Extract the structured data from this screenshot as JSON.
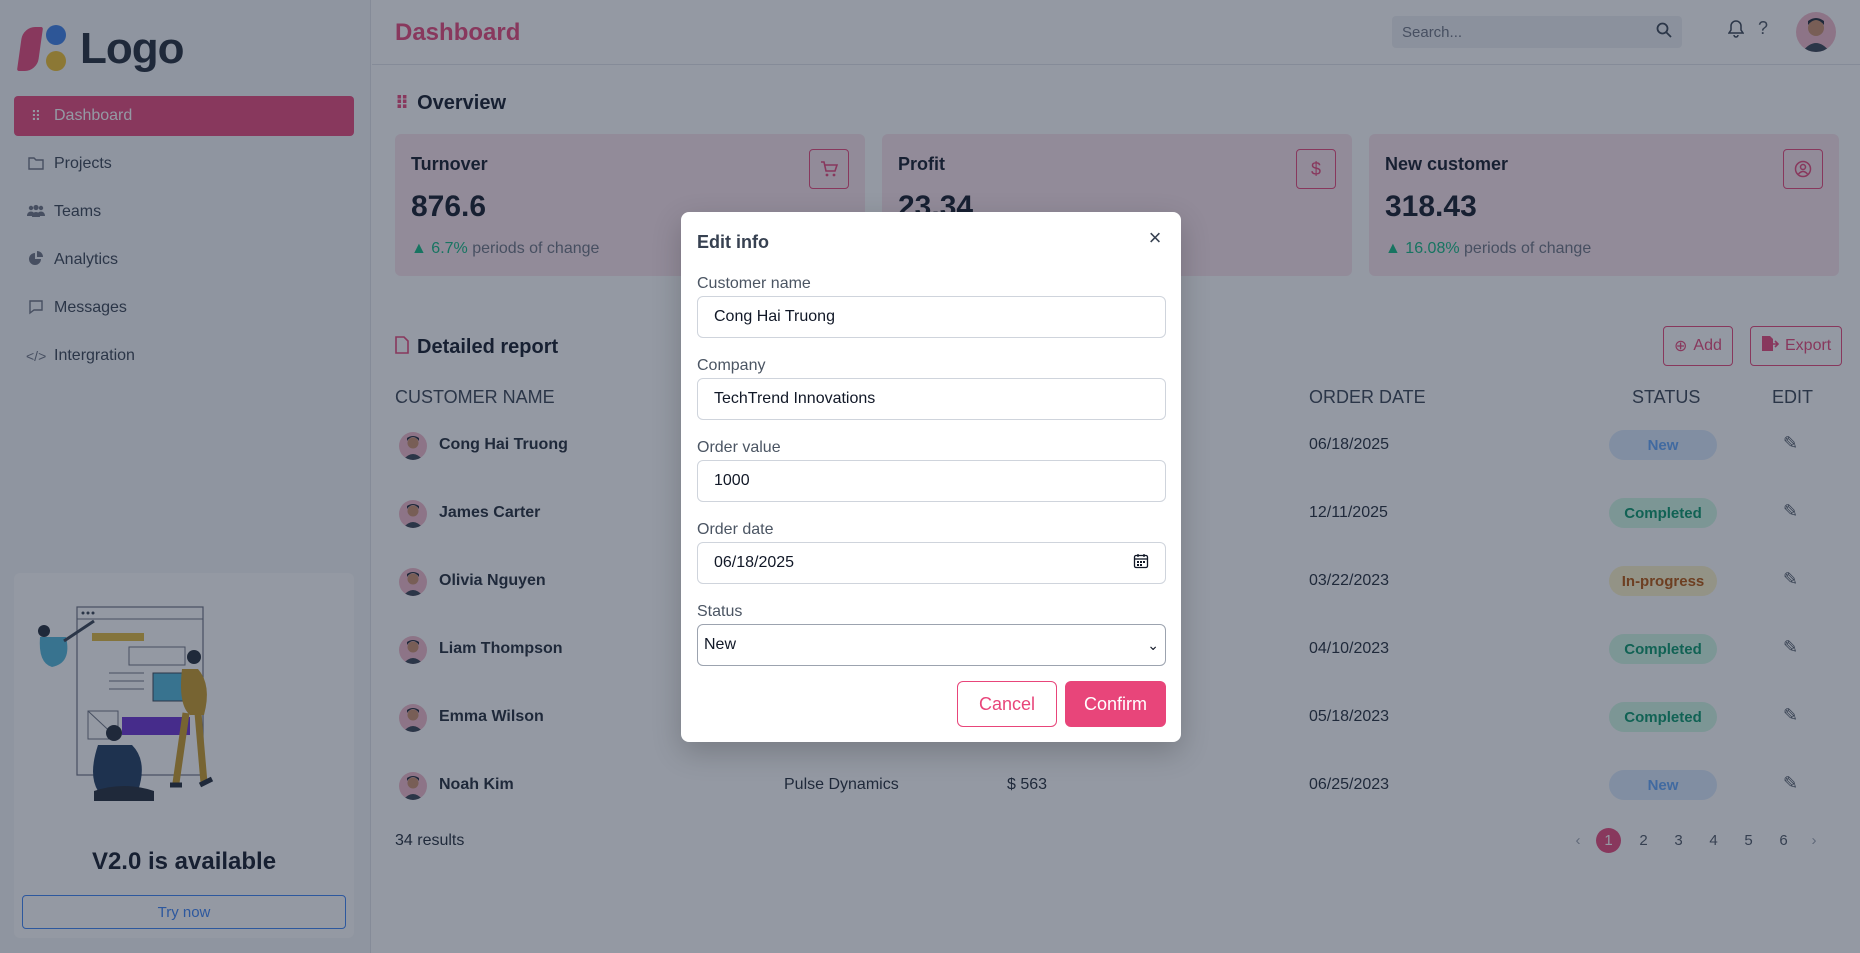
{
  "app": {
    "logo_text": "Logo"
  },
  "sidebar": {
    "items": [
      {
        "label": "Dashboard",
        "icon": "grid-icon"
      },
      {
        "label": "Projects",
        "icon": "folder-icon"
      },
      {
        "label": "Teams",
        "icon": "users-icon"
      },
      {
        "label": "Analytics",
        "icon": "pie-chart-icon"
      },
      {
        "label": "Messages",
        "icon": "message-icon"
      },
      {
        "label": "Intergration",
        "icon": "code-icon"
      }
    ],
    "promo": {
      "title": "V2.0 is available",
      "button": "Try now"
    }
  },
  "header": {
    "title": "Dashboard",
    "search_placeholder": "Search..."
  },
  "overview": {
    "title": "Overview",
    "cards": [
      {
        "title": "Turnover",
        "value": "876.6",
        "pct": "6.7%",
        "suffix": "periods of change",
        "icon": "cart-icon"
      },
      {
        "title": "Profit",
        "value": "23.34",
        "pct": "",
        "suffix": "",
        "icon": "dollar-icon"
      },
      {
        "title": "New customer",
        "value": "318.43",
        "pct": "16.08%",
        "suffix": "periods of change",
        "icon": "user-circle-icon"
      }
    ]
  },
  "report": {
    "title": "Detailed report",
    "add_label": "Add",
    "export_label": "Export",
    "columns": {
      "customer": "CUSTOMER NAME",
      "date": "ORDER DATE",
      "status": "STATUS",
      "edit": "EDIT"
    },
    "rows": [
      {
        "name": "Cong Hai Truong",
        "company": "",
        "value": "",
        "date": "06/18/2025",
        "status": "New"
      },
      {
        "name": "James Carter",
        "company": "",
        "value": "",
        "date": "12/11/2025",
        "status": "Completed"
      },
      {
        "name": "Olivia Nguyen",
        "company": "",
        "value": "",
        "date": "03/22/2023",
        "status": "In-progress"
      },
      {
        "name": "Liam Thompson",
        "company": "",
        "value": "",
        "date": "04/10/2023",
        "status": "Completed"
      },
      {
        "name": "Emma Wilson",
        "company": "",
        "value": "",
        "date": "05/18/2023",
        "status": "Completed"
      },
      {
        "name": "Noah Kim",
        "company": "Pulse Dynamics",
        "value": "$ 563",
        "date": "06/25/2023",
        "status": "New"
      }
    ],
    "results": "34 results",
    "pages": [
      "1",
      "2",
      "3",
      "4",
      "5",
      "6"
    ],
    "prev": "‹",
    "next": "›"
  },
  "modal": {
    "title": "Edit info",
    "close": "×",
    "fields": {
      "customer_label": "Customer name",
      "customer_value": "Cong Hai Truong",
      "company_label": "Company",
      "company_value": "TechTrend Innovations",
      "order_value_label": "Order value",
      "order_value": "1000",
      "order_date_label": "Order date",
      "order_date": "06/18/2025",
      "status_label": "Status",
      "status_value": "New"
    },
    "cancel_label": "Cancel",
    "confirm_label": "Confirm"
  },
  "colors": {
    "accent": "#e8457a",
    "success": "#10b981",
    "info": "#60a5fa",
    "warning": "#b45309"
  }
}
